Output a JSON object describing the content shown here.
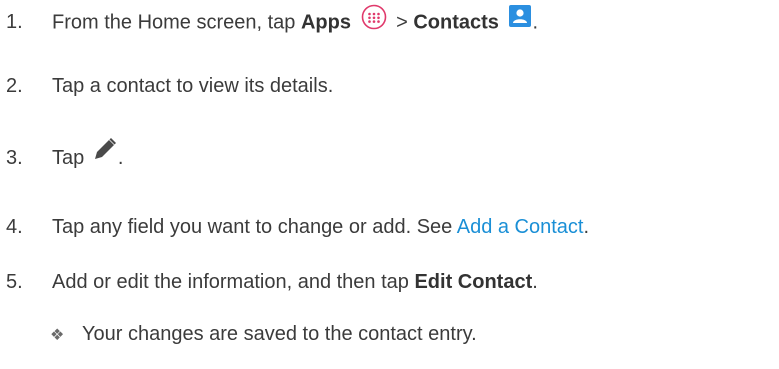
{
  "steps": [
    {
      "number": "1.",
      "before": "From the Home screen, tap ",
      "apps_label": "Apps",
      "separator": " > ",
      "contacts_label": "Contacts",
      "end": "."
    },
    {
      "number": "2.",
      "text": "Tap a contact to view its details."
    },
    {
      "number": "3.",
      "before": "Tap ",
      "end": "."
    },
    {
      "number": "4.",
      "before": "Tap any field you want to change or add. See ",
      "link": "Add a Contact",
      "end": "."
    },
    {
      "number": "5.",
      "before": "Add or edit the information, and then tap ",
      "bold": "Edit Contact",
      "end": "."
    }
  ],
  "result_note": "Your changes are saved to the contact entry.",
  "icons": {
    "apps": "apps-icon",
    "contacts": "contacts-icon",
    "edit": "pencil-icon",
    "bullet": "diamond-bullet-icon"
  },
  "colors": {
    "text": "#3b3b3b",
    "link": "#1a8fd6",
    "apps_icon": "#e0396b",
    "contacts_icon": "#2b8fe0"
  }
}
